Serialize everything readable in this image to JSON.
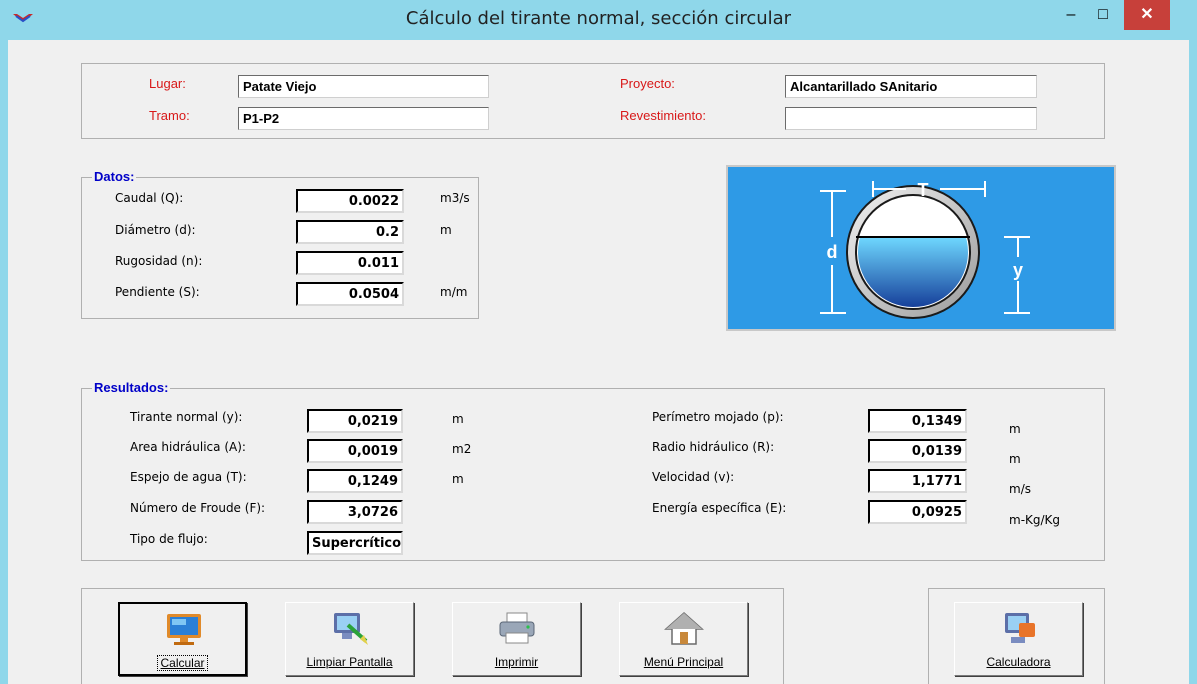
{
  "window": {
    "title": "Cálculo del tirante normal, sección circular",
    "minimize": "–",
    "maximize": "□",
    "close": "✕"
  },
  "header": {
    "lugar_label": "Lugar:",
    "lugar_value": "Patate Viejo",
    "tramo_label": "Tramo:",
    "tramo_value": "P1-P2",
    "proyecto_label": "Proyecto:",
    "proyecto_value": "Alcantarillado SAnitario",
    "revestimiento_label": "Revestimiento:",
    "revestimiento_value": ""
  },
  "datos": {
    "title": "Datos:",
    "rows": [
      {
        "label": "Caudal (Q):",
        "value": "0.0022",
        "unit": "m3/s"
      },
      {
        "label": "Diámetro (d):",
        "value": "0.2",
        "unit": "m"
      },
      {
        "label": "Rugosidad (n):",
        "value": "0.011",
        "unit": ""
      },
      {
        "label": "Pendiente (S):",
        "value": "0.0504",
        "unit": "m/m"
      }
    ]
  },
  "diagram": {
    "t_label": "T",
    "d_label": "d",
    "y_label": "y"
  },
  "resultados": {
    "title": "Resultados:",
    "left": [
      {
        "label": "Tirante normal (y):",
        "value": "0,0219",
        "unit": "m"
      },
      {
        "label": "Area hidráulica (A):",
        "value": "0,0019",
        "unit": "m2"
      },
      {
        "label": "Espejo de agua (T):",
        "value": "0,1249",
        "unit": "m"
      },
      {
        "label": "Número de Froude (F):",
        "value": "3,0726",
        "unit": ""
      },
      {
        "label": "Tipo de flujo:",
        "value": "Supercrítico",
        "unit": ""
      }
    ],
    "right": [
      {
        "label": "Perímetro mojado (p):",
        "value": "0,1349",
        "unit": "m"
      },
      {
        "label": "Radio hidráulico (R):",
        "value": "0,0139",
        "unit": "m"
      },
      {
        "label": "Velocidad (v):",
        "value": "1,1771",
        "unit": "m/s"
      },
      {
        "label": "Energía específica (E):",
        "value": "0,0925",
        "unit": "m-Kg/Kg"
      }
    ]
  },
  "toolbar": {
    "calcular": "Calcular",
    "limpiar": "Limpiar Pantalla",
    "imprimir": "Imprimir",
    "menu": "Menú Principal",
    "calculadora": "Calculadora"
  },
  "colors": {
    "titlebar": "#8fd7ea",
    "close": "#c7403a",
    "group_title": "#0000c8",
    "label_red": "#d81818",
    "diagram_bg": "#2e9ae6"
  }
}
